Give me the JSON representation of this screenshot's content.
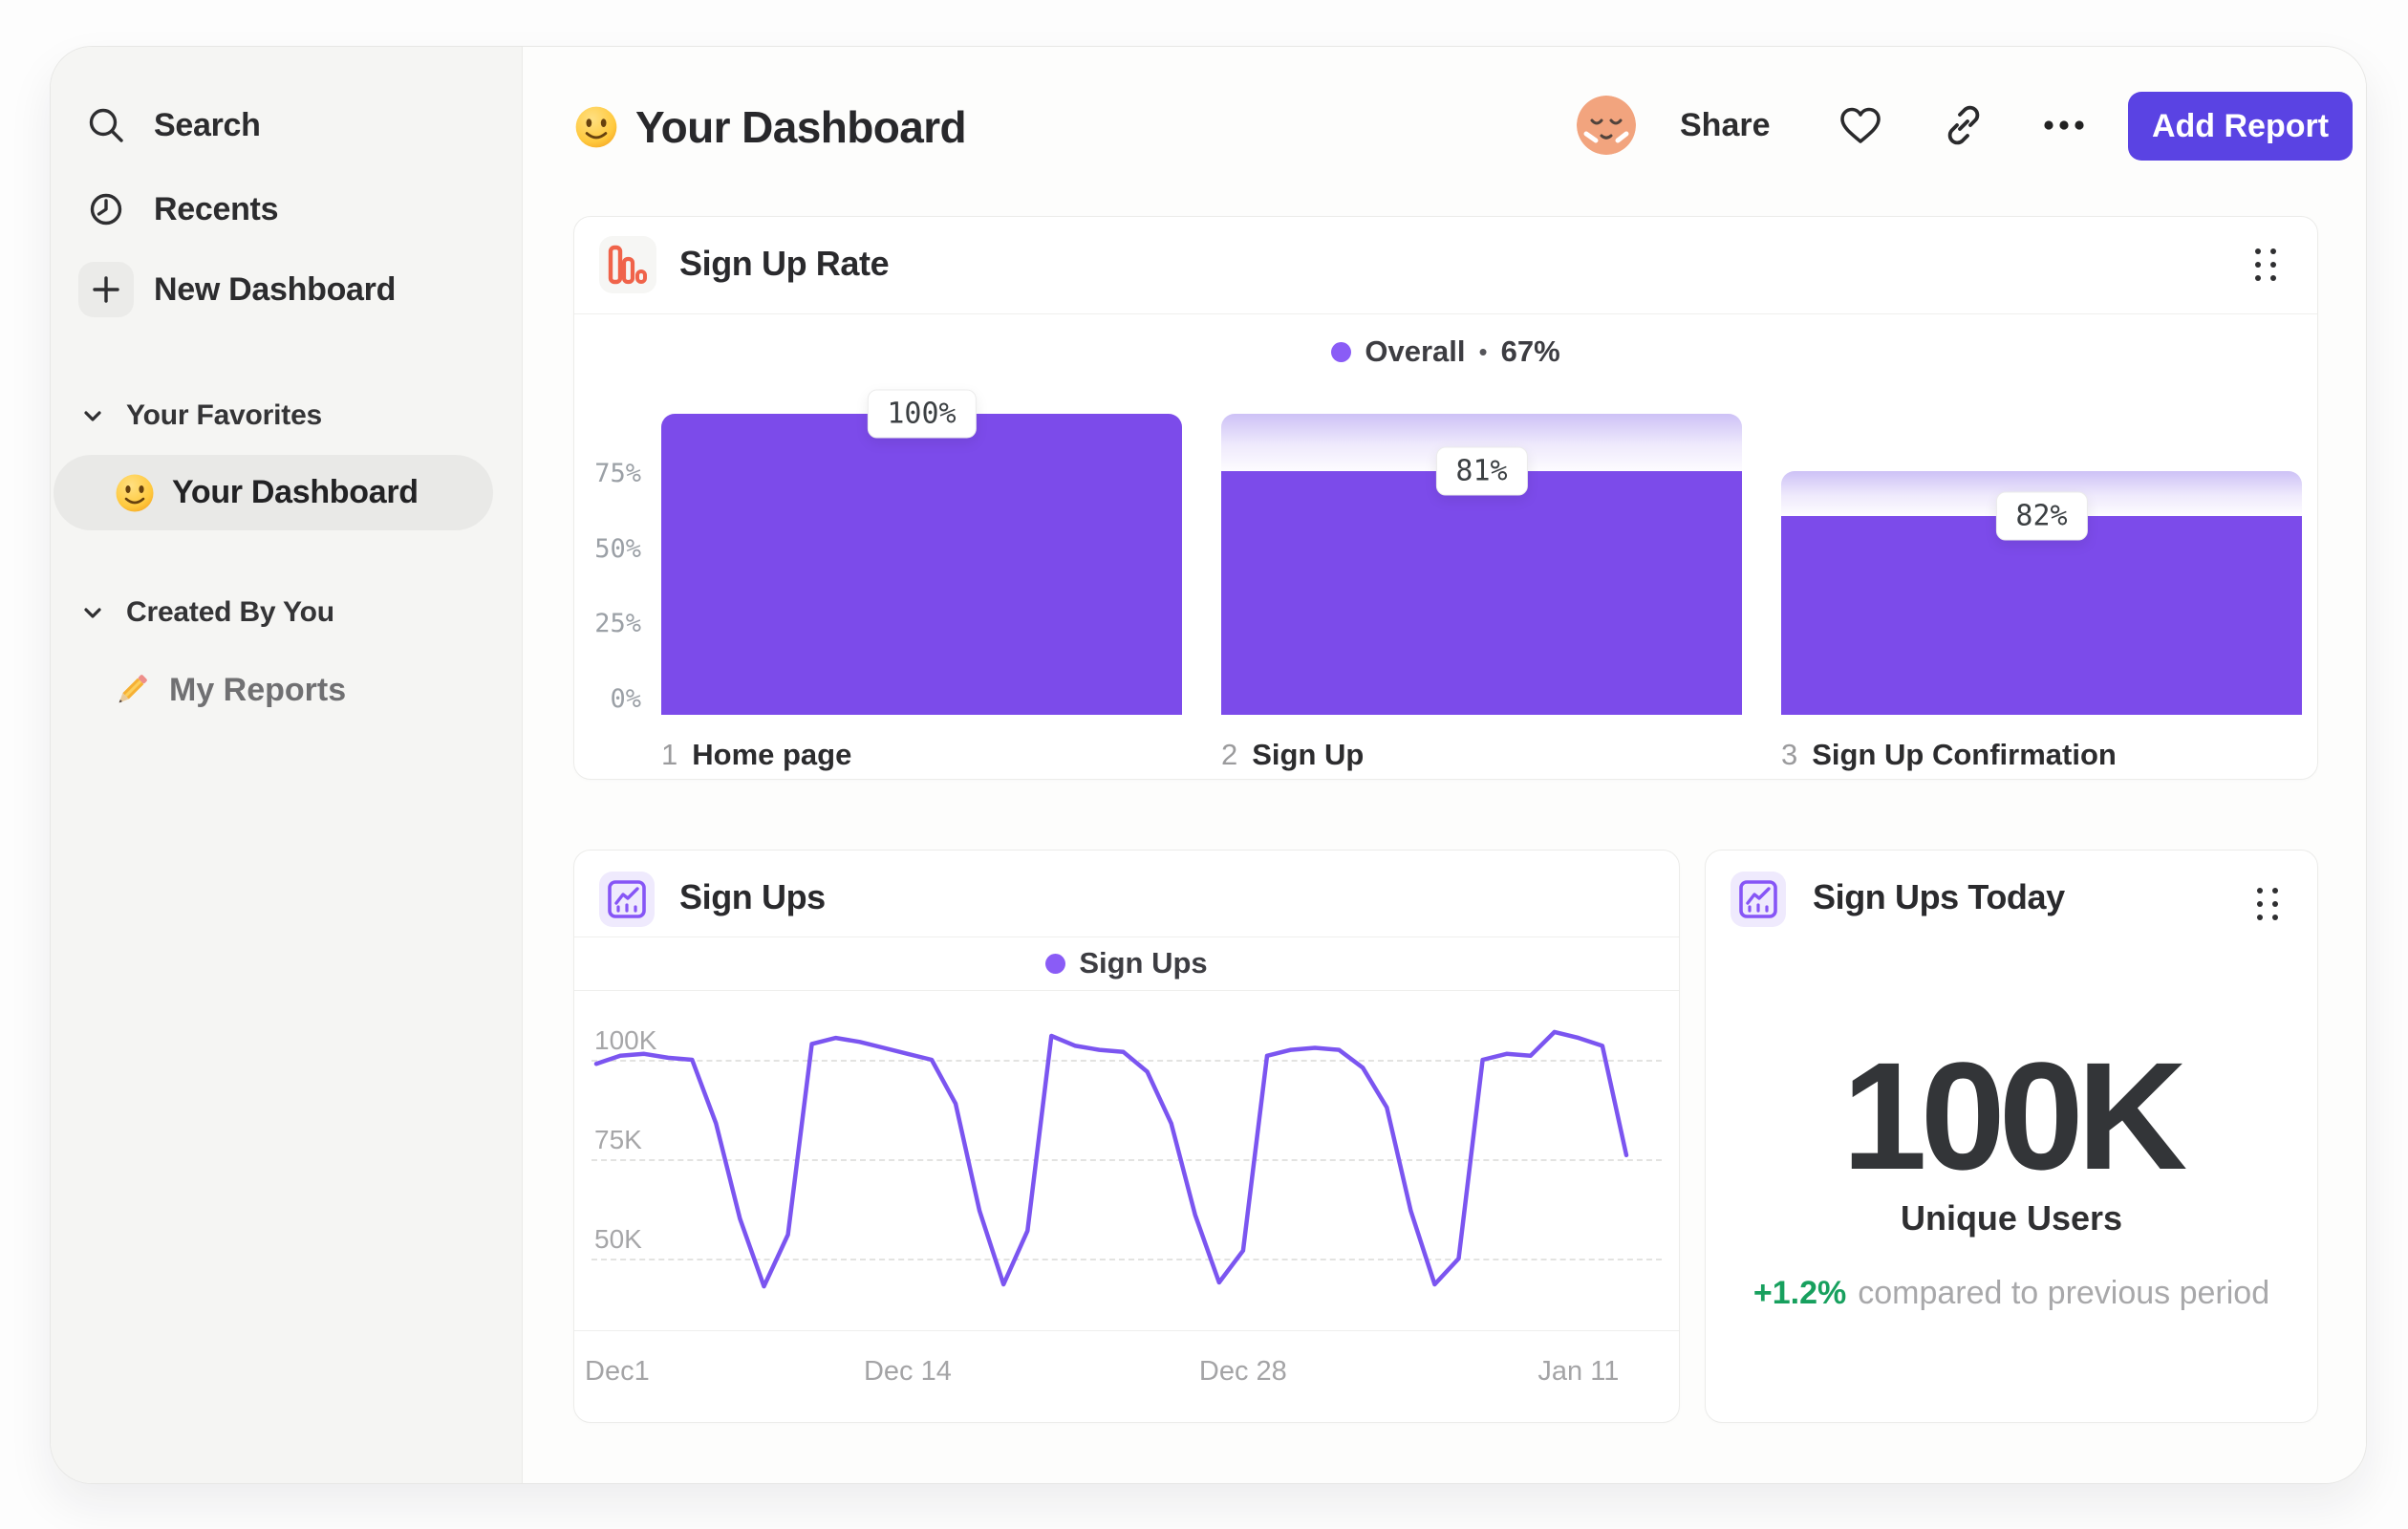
{
  "sidebar": {
    "top_items": [
      {
        "label": "Search"
      },
      {
        "label": "Recents"
      },
      {
        "label": "New Dashboard"
      }
    ],
    "sections": [
      {
        "title": "Your Favorites",
        "items": [
          {
            "label": "Your Dashboard",
            "selected": true
          }
        ]
      },
      {
        "title": "Created By You",
        "items": [
          {
            "label": "My Reports",
            "selected": false
          }
        ]
      }
    ]
  },
  "header": {
    "title": "Your Dashboard",
    "share": "Share",
    "add_report": "Add Report"
  },
  "funnel_card": {
    "title": "Sign Up Rate",
    "legend": {
      "label": "Overall",
      "sep": "•",
      "value": "67%"
    },
    "y_ticks": [
      {
        "label": "75%",
        "pct": 75
      },
      {
        "label": "50%",
        "pct": 50
      },
      {
        "label": "25%",
        "pct": 25
      },
      {
        "label": "0%",
        "pct": 0
      }
    ],
    "steps": [
      {
        "num": "1",
        "label": "Home page",
        "value": "100%",
        "bar_pct": 100,
        "ghost_from_pct": null
      },
      {
        "num": "2",
        "label": "Sign Up",
        "value": "81%",
        "bar_pct": 81,
        "ghost_from_pct": 100
      },
      {
        "num": "3",
        "label": "Sign Up Confirmation",
        "value": "82%",
        "bar_pct": 66,
        "ghost_from_pct": 81
      }
    ]
  },
  "line_card": {
    "title": "Sign Ups",
    "legend": "Sign Ups",
    "y_ticks": [
      {
        "label": "100K",
        "value": 100
      },
      {
        "label": "75K",
        "value": 75
      },
      {
        "label": "50K",
        "value": 50
      }
    ],
    "x_ticks": [
      {
        "label": "Dec1",
        "day": 0
      },
      {
        "label": "Dec 14",
        "day": 13
      },
      {
        "label": "Dec 28",
        "day": 27
      },
      {
        "label": "Jan 11",
        "day": 41
      }
    ],
    "unit": "K",
    "values": [
      99,
      101,
      101.5,
      100.5,
      100,
      84,
      60,
      43,
      56,
      104,
      105.5,
      104.5,
      103,
      101.5,
      100,
      89,
      62,
      43.5,
      57,
      106,
      103.5,
      102.5,
      102,
      97,
      84,
      61,
      44,
      52,
      101,
      102.5,
      103,
      102.5,
      98,
      88,
      62,
      43.5,
      50,
      100,
      101.5,
      101,
      107,
      105.5,
      103.5,
      76
    ]
  },
  "metric_card": {
    "title": "Sign Ups Today",
    "value": "100K",
    "caption": "Unique Users",
    "delta": "+1.2%",
    "delta_caption": "compared to previous period"
  },
  "colors": {
    "accent_button": "#5A43E3",
    "bar": "#7C4BEA",
    "bar_ghost_top": "#CDC1F6",
    "legend_dot": "#8A5CF6",
    "line": "#7B55F0",
    "positive_green": "#17A05E",
    "funnel_icon_orange": "#F0634A",
    "chart_icon_purple": "#8655F6",
    "avatar_bg": "#F2A47E"
  }
}
